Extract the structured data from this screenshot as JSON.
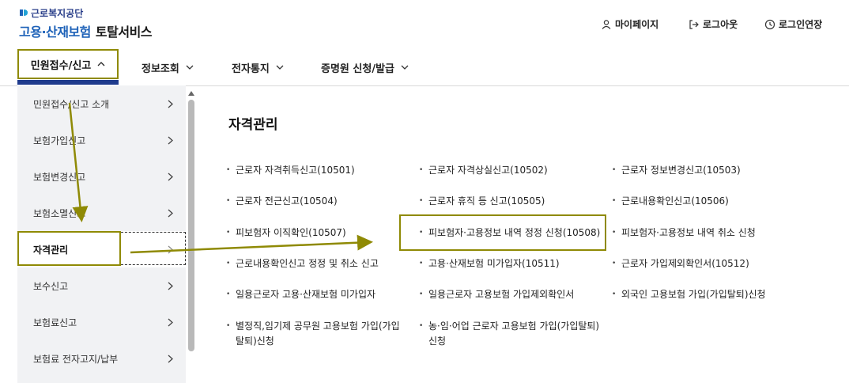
{
  "header": {
    "org_name": "근로복지공단",
    "service_blue": "고용·산재보험",
    "service_dark": "토탈서비스",
    "util": {
      "mypage": "마이페이지",
      "logout": "로그아웃",
      "extend": "로그인연장"
    }
  },
  "gnb": {
    "items": [
      {
        "label": "민원접수/신고"
      },
      {
        "label": "정보조회"
      },
      {
        "label": "전자통지"
      },
      {
        "label": "증명원 신청/발급"
      }
    ]
  },
  "sidebar": {
    "items": [
      {
        "label": "민원접수/신고 소개"
      },
      {
        "label": "보험가입신고"
      },
      {
        "label": "보험변경신고"
      },
      {
        "label": "보험소멸신고"
      },
      {
        "label": "자격관리"
      },
      {
        "label": "보수신고"
      },
      {
        "label": "보험료신고"
      },
      {
        "label": "보험료 전자고지/납부"
      }
    ]
  },
  "content": {
    "title": "자격관리",
    "links": [
      "근로자 자격취득신고(10501)",
      "근로자 자격상실신고(10502)",
      "근로자 정보변경신고(10503)",
      "근로자 전근신고(10504)",
      "근로자 휴직 등 신고(10505)",
      "근로내용확인신고(10506)",
      "피보험자 이직확인(10507)",
      "피보험자·고용정보 내역 정정 신청(10508)",
      "피보험자·고용정보 내역 취소 신청",
      "근로내용확인신고 정정 및 취소 신고",
      "고용·산재보험 미가입자(10511)",
      "근로자 가입제외확인서(10512)",
      "일용근로자 고용·산재보험 미가입자",
      "일용근로자 고용보험 가입제외확인서",
      "외국인 고용보험 가입(가입탈퇴)신청",
      "별정직,임기제 공무원 고용보험 가입(가입탈퇴)신청",
      "농·임·어업 근로자 고용보험 가입(가입탈퇴)신청"
    ]
  },
  "colors": {
    "highlight": "#8f8a05",
    "brand": "#1f3b8d",
    "sidebar_bg": "#f1f2f4"
  }
}
